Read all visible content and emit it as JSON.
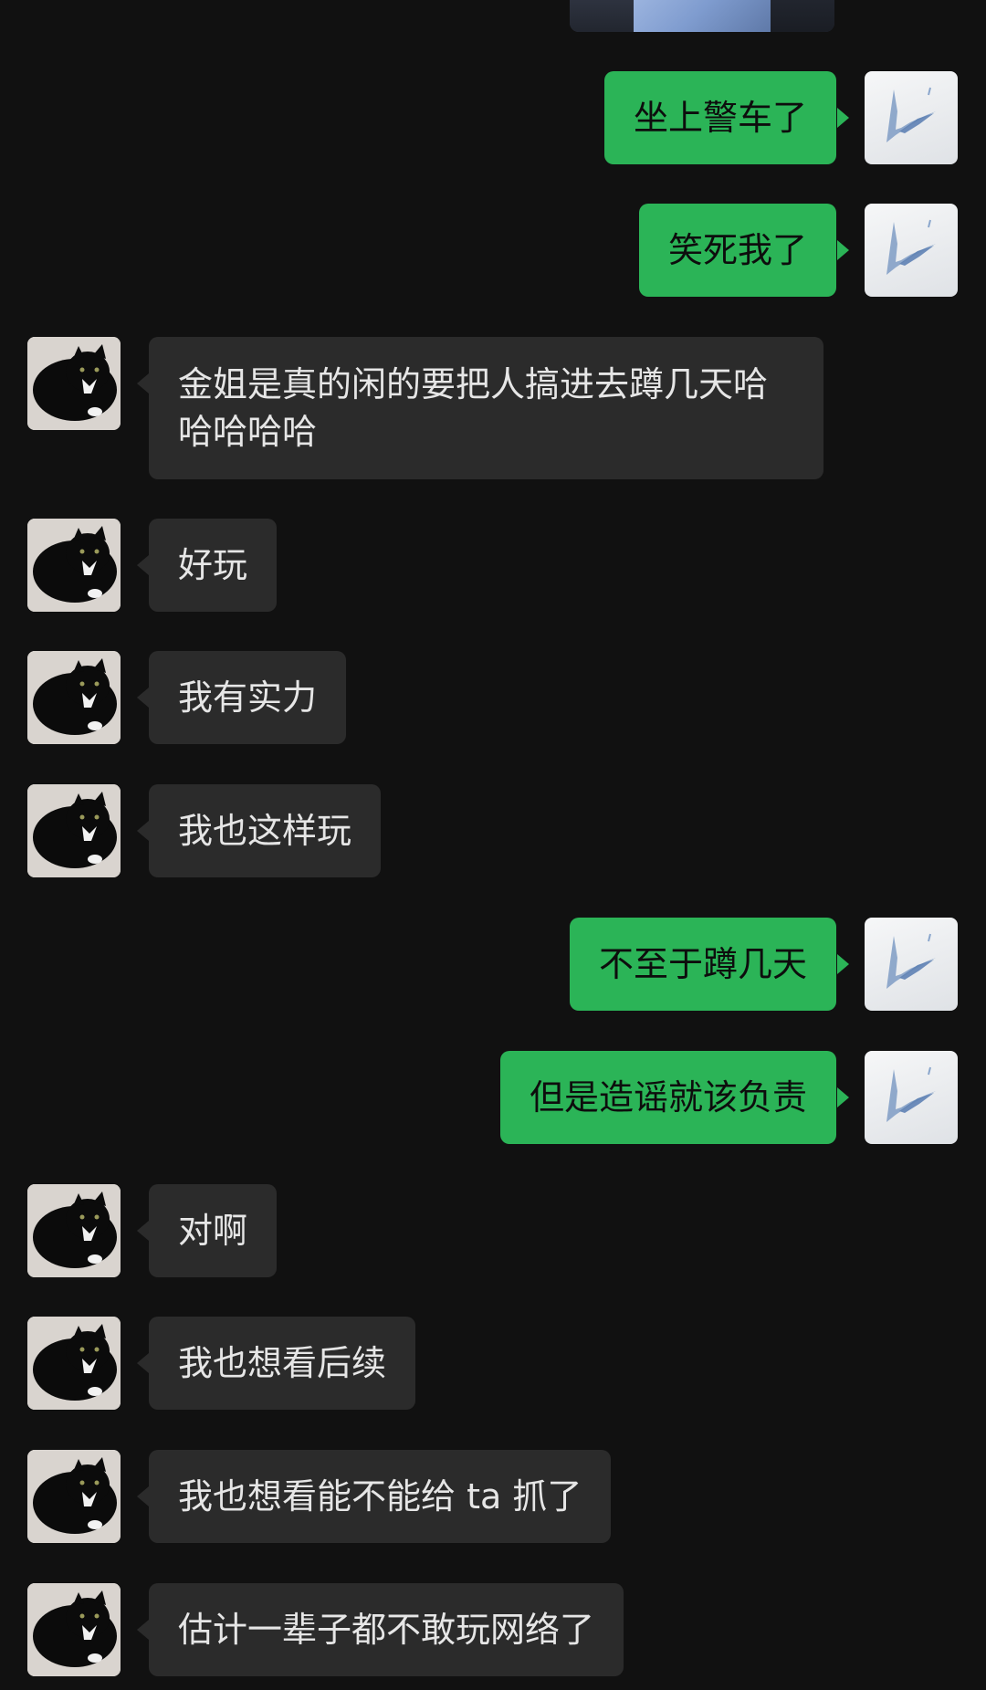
{
  "messages": [
    {
      "side": "sent",
      "text": "坐上警车了"
    },
    {
      "side": "sent",
      "text": "笑死我了"
    },
    {
      "side": "recv",
      "text": "金姐是真的闲的要把人搞进去蹲几天哈哈哈哈哈"
    },
    {
      "side": "recv",
      "text": "好玩"
    },
    {
      "side": "recv",
      "text": "我有实力"
    },
    {
      "side": "recv",
      "text": "我也这样玩"
    },
    {
      "side": "sent",
      "text": "不至于蹲几天"
    },
    {
      "side": "sent",
      "text": "但是造谣就该负责"
    },
    {
      "side": "recv",
      "text": "对啊"
    },
    {
      "side": "recv",
      "text": "我也想看后续"
    },
    {
      "side": "recv",
      "text": "我也想看能不能给 ta 抓了"
    },
    {
      "side": "recv",
      "text": "估计一辈子都不敢玩网络了"
    }
  ],
  "colors": {
    "background": "#111111",
    "sent_bubble": "#2bb457",
    "received_bubble": "#2b2b2b"
  },
  "icons": {
    "self_avatar": "dragon-sketch-avatar-icon",
    "contact_avatar": "black-cat-avatar-icon"
  }
}
